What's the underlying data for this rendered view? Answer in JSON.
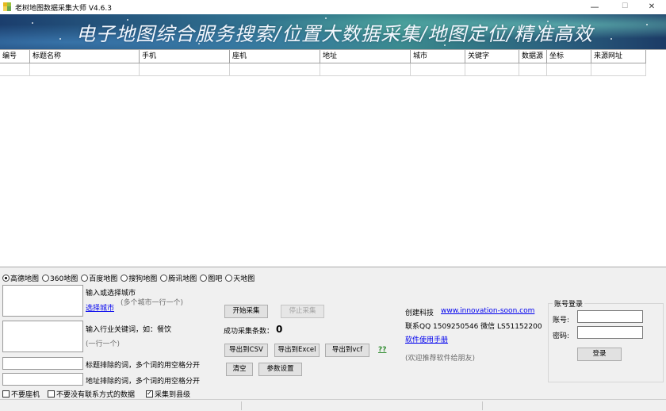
{
  "window": {
    "title": "老树地图数据采集大师 V4.6.3",
    "controls": {
      "minimize": "—",
      "maximize": "☐",
      "close": "✕"
    }
  },
  "banner": {
    "slogan": "电子地图综合服务搜索/位置大数据采集/地图定位/精准高效"
  },
  "table": {
    "columns": [
      "编号",
      "标题名称",
      "手机",
      "座机",
      "地址",
      "城市",
      "关键字",
      "数据源",
      "坐标",
      "来源网址"
    ],
    "rows": []
  },
  "map_sources": {
    "options": [
      "高德地图",
      "360地图",
      "百度地图",
      "搜狗地图",
      "腾讯地图",
      "图吧",
      "天地图"
    ],
    "selected": "高德地图"
  },
  "city": {
    "label": "输入或选择城市",
    "select_link": "选择城市",
    "hint": "(多个城市一行一个)",
    "value": ""
  },
  "keyword": {
    "label": "输入行业关键词，如：餐饮",
    "hint": "(一行一个)",
    "value": ""
  },
  "title_exclude": {
    "label": "标题排除的词，多个词的用空格分开",
    "value": ""
  },
  "address_exclude": {
    "label": "地址排除的词，多个词的用空格分开",
    "value": ""
  },
  "options": {
    "no_landline": {
      "label": "不要座机",
      "checked": false
    },
    "no_contact": {
      "label": "不要没有联系方式的数据",
      "checked": false
    },
    "county_level": {
      "label": "采集到县级",
      "checked": true
    }
  },
  "actions": {
    "start": "开始采集",
    "stop": "停止采集",
    "success_label": "成功采集条数：",
    "success_count": "0",
    "export_csv": "导出到CSV",
    "export_excel": "导出到Excel",
    "export_vcf": "导出到vcf",
    "help": "??",
    "clear": "清空",
    "settings": "参数设置"
  },
  "company": {
    "name": "创建科技",
    "url": "www.innovation-soon.com",
    "contact": "联系QQ 1509250546  微信 LS51152200",
    "manual": "软件使用手册",
    "recommend": "(欢迎推荐软件给朋友)"
  },
  "login": {
    "title": "账号登录",
    "account_label": "账号:",
    "password_label": "密码:",
    "account_value": "",
    "password_value": "",
    "button": "登录"
  }
}
